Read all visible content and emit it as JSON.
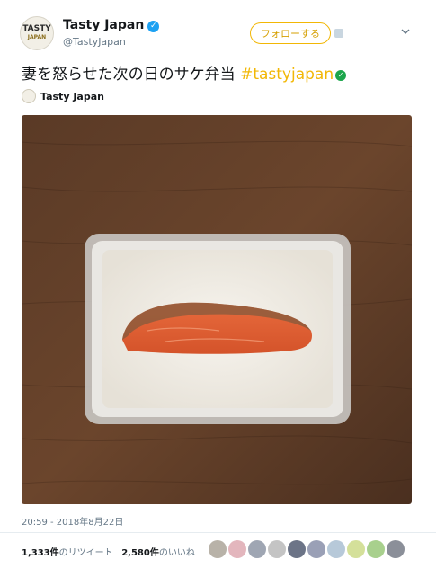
{
  "account": {
    "name": "Tasty Japan",
    "handle": "@TastyJapan",
    "logo_text": "TASTY",
    "logo_sub": "JAPAN"
  },
  "follow_label": "フォローする",
  "tweet": {
    "text": "妻を怒らせた次の日のサケ弁当 ",
    "hashtag": "#tastyjapan"
  },
  "embedded_credit": "Tasty Japan",
  "timestamp": "20:59 - 2018年8月22日",
  "stats": {
    "retweets_count": "1,333件",
    "retweets_label": "のリツイート",
    "likes_count": "2,580件",
    "likes_label": "のいいね"
  },
  "colors": {
    "accent": "#f2b705",
    "verified": "#1da1f2",
    "hashtag_check": "#1ca64c"
  },
  "liker_colors": [
    "#b8b2a8",
    "#e3b6bd",
    "#9fa6b3",
    "#c4c4c4",
    "#6c7487",
    "#9aa0b6",
    "#b7c9d9",
    "#d4e09a",
    "#a8d08d",
    "#8b8f99"
  ]
}
